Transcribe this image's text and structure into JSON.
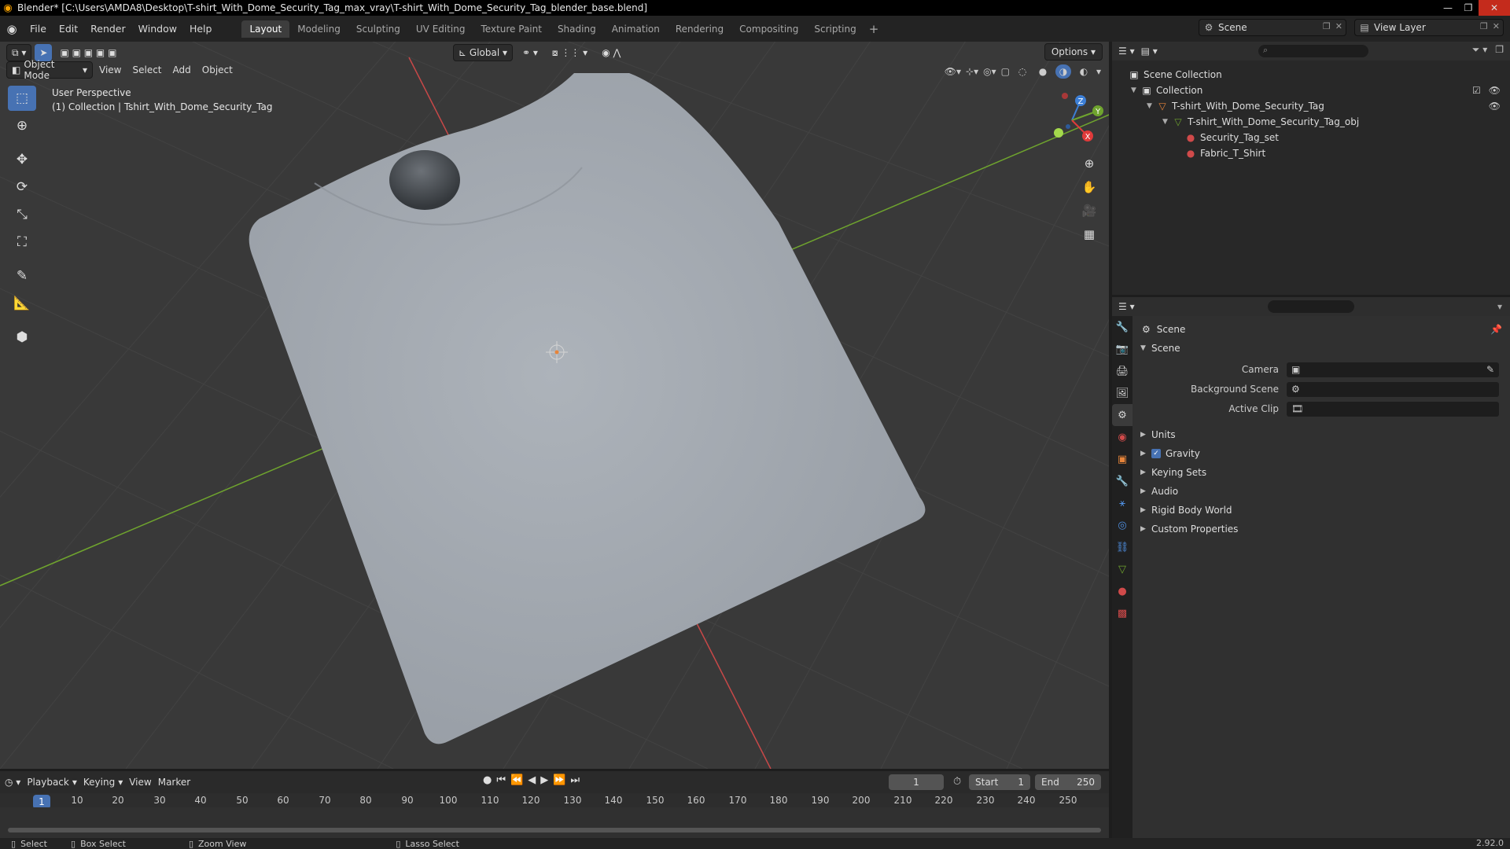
{
  "window": {
    "title": "Blender* [C:\\Users\\AMDA8\\Desktop\\T-shirt_With_Dome_Security_Tag_max_vray\\T-shirt_With_Dome_Security_Tag_blender_base.blend]",
    "minimize": "—",
    "maximize": "❐",
    "close": "✕"
  },
  "menu": [
    "File",
    "Edit",
    "Render",
    "Window",
    "Help"
  ],
  "workspaces": [
    {
      "label": "Layout",
      "active": true
    },
    {
      "label": "Modeling",
      "active": false
    },
    {
      "label": "Sculpting",
      "active": false
    },
    {
      "label": "UV Editing",
      "active": false
    },
    {
      "label": "Texture Paint",
      "active": false
    },
    {
      "label": "Shading",
      "active": false
    },
    {
      "label": "Animation",
      "active": false
    },
    {
      "label": "Rendering",
      "active": false
    },
    {
      "label": "Compositing",
      "active": false
    },
    {
      "label": "Scripting",
      "active": false
    }
  ],
  "workspace_add": "+",
  "scene_selector": {
    "value": "Scene"
  },
  "view_layer_selector": {
    "value": "View Layer"
  },
  "viewport": {
    "mode": "Object Mode",
    "menus": [
      "View",
      "Select",
      "Add",
      "Object"
    ],
    "orientation": "Global",
    "options": "Options",
    "info_line1": "User Perspective",
    "info_line2": "(1) Collection | Tshirt_With_Dome_Security_Tag",
    "gizmo_labels": {
      "x": "X",
      "y": "Y",
      "z": "Z"
    }
  },
  "timeline": {
    "menus": [
      "Playback",
      "Keying",
      "View",
      "Marker"
    ],
    "current_frame": "1",
    "start_label": "Start",
    "start_value": "1",
    "end_label": "End",
    "end_value": "250",
    "playhead": "1",
    "ticks": [
      "10",
      "20",
      "30",
      "40",
      "50",
      "60",
      "70",
      "80",
      "90",
      "100",
      "110",
      "120",
      "130",
      "140",
      "150",
      "160",
      "170",
      "180",
      "190",
      "200",
      "210",
      "220",
      "230",
      "240",
      "250"
    ]
  },
  "statusbar": {
    "select": "Select",
    "box_select": "Box Select",
    "zoom_view": "Zoom View",
    "lasso_select": "Lasso Select",
    "version": "2.92.0"
  },
  "outliner": {
    "root": "Scene Collection",
    "collection": "Collection",
    "object": "T-shirt_With_Dome_Security_Tag",
    "mesh": "T-shirt_With_Dome_Security_Tag_obj",
    "materials": [
      "Security_Tag_set",
      "Fabric_T_Shirt"
    ]
  },
  "properties": {
    "context": "Scene",
    "panel_scene": "Scene",
    "camera_label": "Camera",
    "background_scene_label": "Background Scene",
    "active_clip_label": "Active Clip",
    "panels": [
      "Units",
      "Gravity",
      "Keying Sets",
      "Audio",
      "Rigid Body World",
      "Custom Properties"
    ]
  },
  "colors": {
    "accent": "#4772b3",
    "x_axis": "#e03a3a",
    "y_axis": "#6fa42e",
    "z_axis": "#3d7fd6",
    "shirt": "#a7adb4"
  }
}
